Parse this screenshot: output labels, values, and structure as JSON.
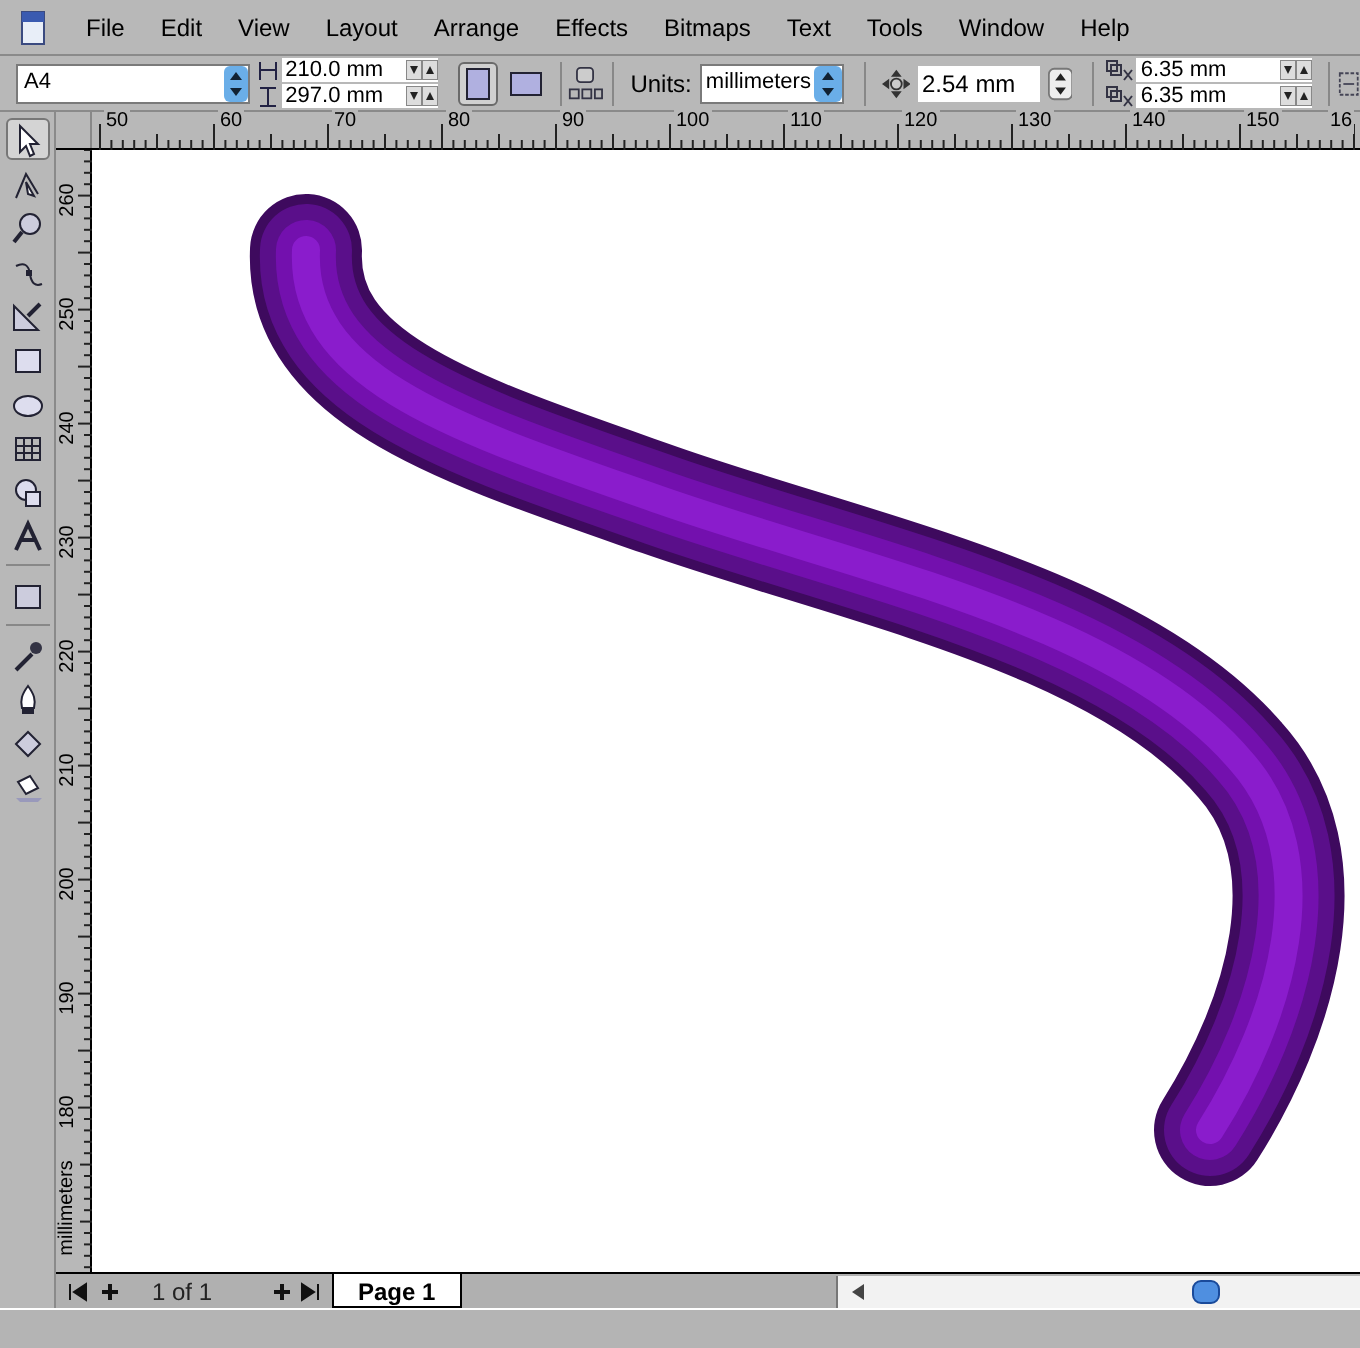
{
  "menu": [
    "File",
    "Edit",
    "View",
    "Layout",
    "Arrange",
    "Effects",
    "Bitmaps",
    "Text",
    "Tools",
    "Window",
    "Help"
  ],
  "property_bar": {
    "paper_size": "A4",
    "width": "210.0 mm",
    "height": "297.0 mm",
    "orientation": [
      {
        "kind": "portrait",
        "selected": true
      },
      {
        "kind": "landscape",
        "selected": false
      }
    ],
    "units_label": "Units:",
    "units": "millimeters",
    "nudge": "2.54 mm",
    "duplicate_x": "6.35 mm",
    "duplicate_y": "6.35 mm"
  },
  "toolbox": [
    {
      "kind": "pick",
      "selected": true
    },
    {
      "kind": "shape",
      "selected": false
    },
    {
      "kind": "zoom",
      "selected": false
    },
    {
      "kind": "curve",
      "selected": false
    },
    {
      "kind": "smart",
      "selected": false
    },
    {
      "kind": "rectangle",
      "selected": false
    },
    {
      "kind": "ellipse",
      "selected": false
    },
    {
      "kind": "table",
      "selected": false
    },
    {
      "kind": "shapes",
      "selected": false
    },
    {
      "kind": "text",
      "selected": false
    },
    {
      "kind": "interactive",
      "selected": false
    },
    {
      "kind": "eyedropper",
      "selected": false
    },
    {
      "kind": "outline",
      "selected": false
    },
    {
      "kind": "fill",
      "selected": false
    },
    {
      "kind": "interactive-fill",
      "selected": false
    }
  ],
  "horizontal_ruler": [
    "50",
    "60",
    "70",
    "80",
    "90",
    "100",
    "110",
    "120",
    "130",
    "140",
    "150",
    "16"
  ],
  "vertical_ruler": {
    "labels": [
      "260",
      "250",
      "240",
      "230",
      "220",
      "210",
      "200",
      "190",
      "180"
    ],
    "units": "millimeters"
  },
  "page_nav": {
    "count": "1 of 1",
    "tabs": [
      {
        "label": "Page 1",
        "selected": true
      }
    ]
  }
}
